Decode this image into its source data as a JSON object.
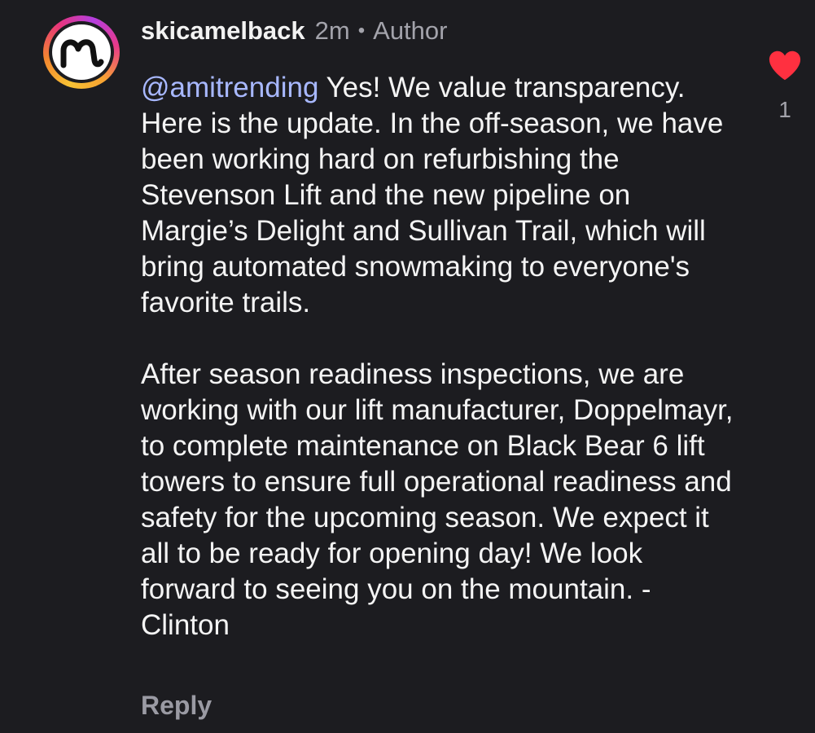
{
  "comment": {
    "username": "skicamelback",
    "timestamp": "2m",
    "separator": "•",
    "author_badge": "Author",
    "mention": "@amitrending",
    "paragraph1_text": " Yes! We value transparency. Here is the update. In the off-season, we have been working hard on refurbishing the Stevenson Lift and the new pipeline on Margie’s Delight and Sullivan Trail, which will bring automated snowmaking to everyone's favorite trails.",
    "paragraph2_text": "After season readiness inspections, we are working with our lift manufacturer, Doppelmayr, to complete maintenance on Black Bear 6 lift towers to ensure full operational readiness and safety for the upcoming season. We expect it all to be ready for opening day!  We look forward to seeing you on the mountain. - Clinton",
    "reply_label": "Reply",
    "like_count": "1",
    "avatar_icon": "camelback-logo-icon",
    "like_icon": "heart-icon"
  },
  "colors": {
    "background": "#1c1c20",
    "text": "#f4f4f4",
    "muted": "#a3a3ab",
    "mention": "#a8b8ff",
    "heart": "#ff3040"
  }
}
